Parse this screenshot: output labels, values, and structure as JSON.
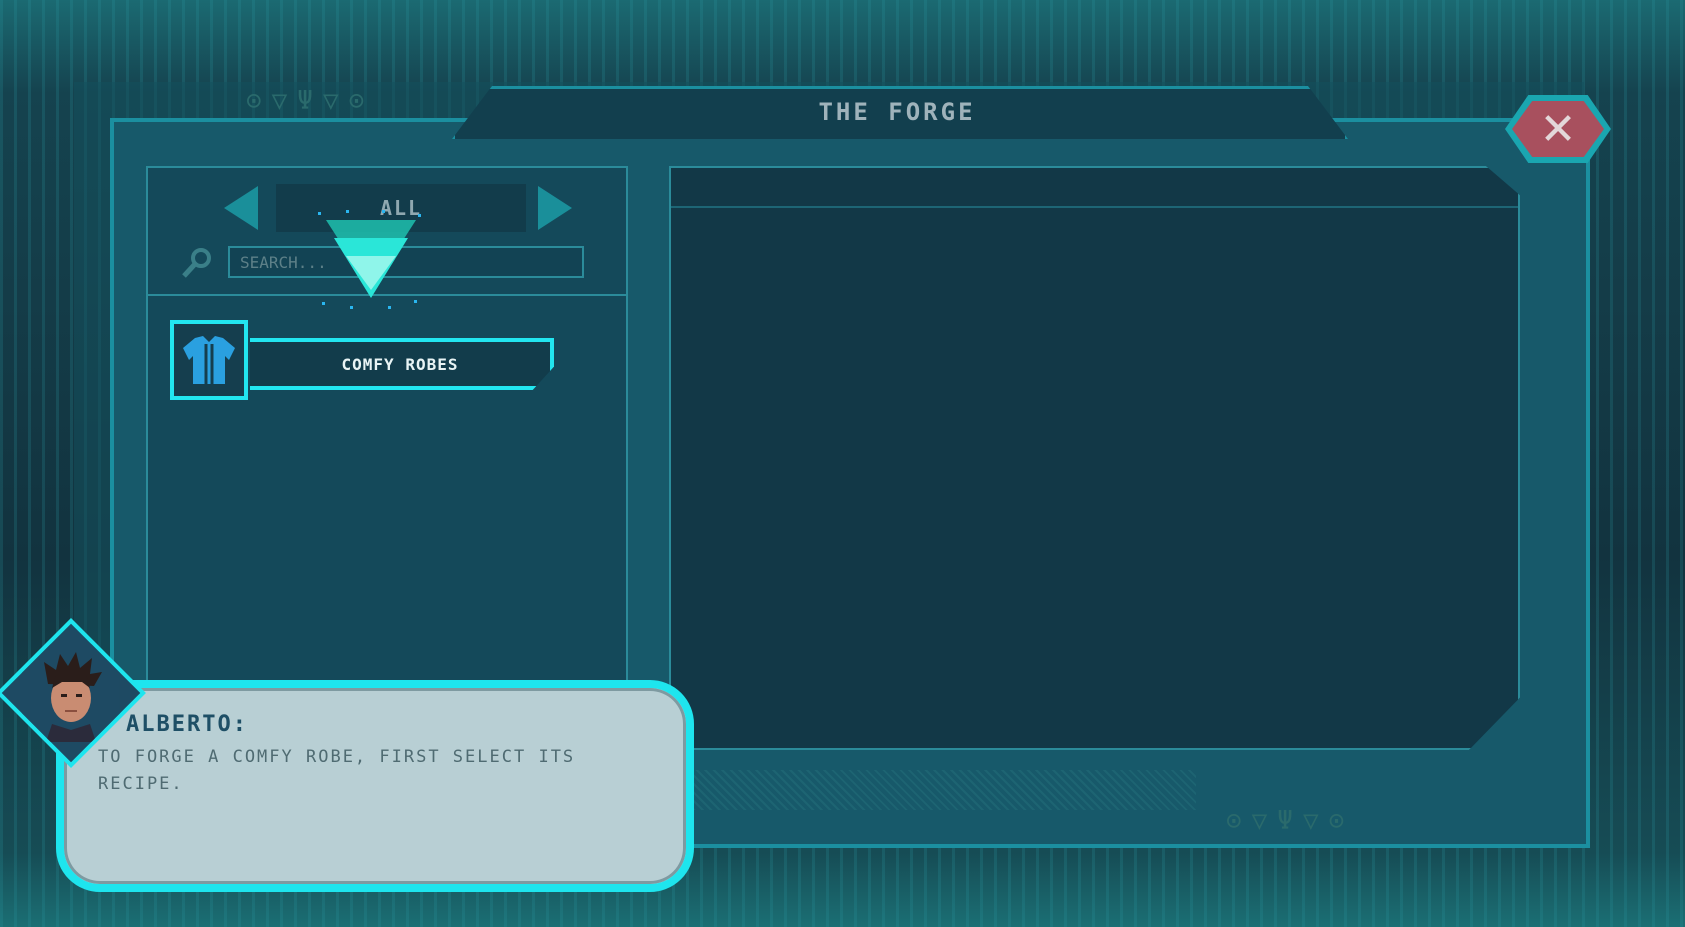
{
  "window": {
    "title": "THE FORGE",
    "close_icon": "close-x-icon",
    "accent_color": "#22e6f0",
    "close_color": "#a8505e"
  },
  "decor": {
    "top_glyphs": "⊙▽Ψ▽⊙",
    "bottom_glyphs": "⊙▽Ψ▽⊙"
  },
  "recipe_panel": {
    "category": "ALL",
    "prev_icon": "triangle-left-icon",
    "next_icon": "triangle-right-icon",
    "search_icon": "magnifier-icon",
    "search_placeholder": "SEARCH...",
    "items": [
      {
        "label": "COMFY ROBES",
        "icon": "robe-icon"
      }
    ]
  },
  "tutorial_pointer": {
    "icon": "chevron-down-pointer-icon"
  },
  "dialog": {
    "speaker": "ALBERTO:",
    "text": "TO FORGE A COMFY ROBE, FIRST SELECT ITS RECIPE.",
    "portrait_icon": "alberto-portrait-icon"
  }
}
